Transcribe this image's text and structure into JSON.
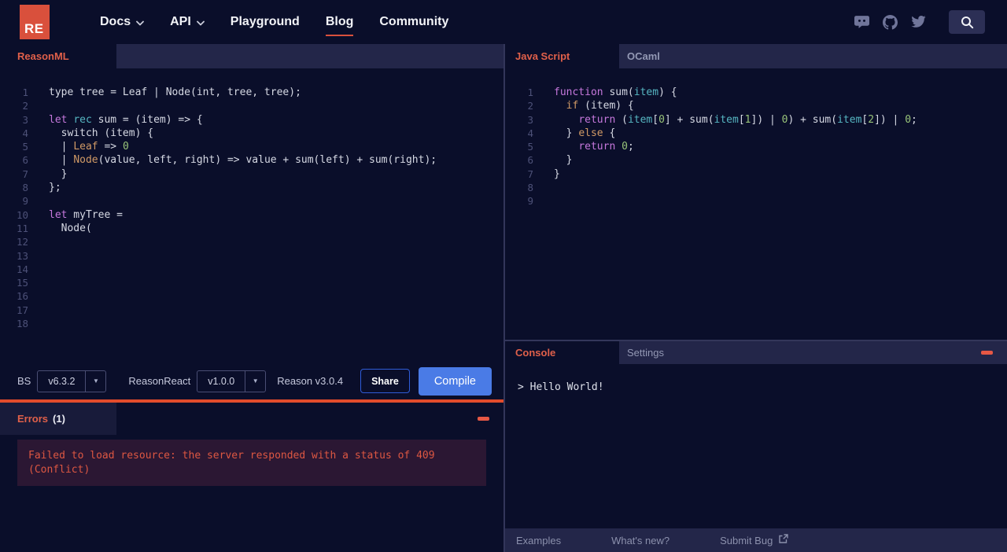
{
  "accent": {
    "red": "#d9503c",
    "divider_orange": "#e24c2c",
    "compile_blue": "#4a7be6",
    "tab_label_red": "#e0604a"
  },
  "nav": {
    "logo_text": "RE",
    "items": [
      {
        "label": "Docs",
        "chevron": true,
        "active": false
      },
      {
        "label": "API",
        "chevron": true,
        "active": false
      },
      {
        "label": "Playground",
        "chevron": false,
        "active": false
      },
      {
        "label": "Blog",
        "chevron": false,
        "active": true
      },
      {
        "label": "Community",
        "chevron": false,
        "active": false
      }
    ],
    "social_icons": [
      "discord",
      "github",
      "twitter"
    ],
    "search_icon": "search"
  },
  "left_editor": {
    "tab_label": "ReasonML",
    "lines": [
      [
        [
          "p",
          "type tree = Leaf | Node(int, tree, tree);"
        ]
      ],
      [],
      [
        [
          "m",
          "let"
        ],
        [
          "p",
          " "
        ],
        [
          "c",
          "rec"
        ],
        [
          "p",
          " sum = (item) => {"
        ]
      ],
      [
        [
          "p",
          "  switch (item) {"
        ]
      ],
      [
        [
          "p",
          "  | "
        ],
        [
          "o",
          "Leaf"
        ],
        [
          "p",
          " => "
        ],
        [
          "g",
          "0"
        ]
      ],
      [
        [
          "p",
          "  | "
        ],
        [
          "o",
          "Node"
        ],
        [
          "p",
          "(value, left, right) => value + sum(left) + sum(right);"
        ]
      ],
      [
        [
          "p",
          "  }"
        ]
      ],
      [
        [
          "p",
          "};"
        ]
      ],
      [],
      [
        [
          "m",
          "let"
        ],
        [
          "p",
          " myTree ="
        ]
      ],
      [
        [
          "p",
          "  Node("
        ]
      ],
      [],
      [],
      [],
      [],
      [],
      [],
      []
    ]
  },
  "right_editor": {
    "tabs": [
      {
        "label": "Java Script",
        "active": true
      },
      {
        "label": "OCaml",
        "active": false
      }
    ],
    "lines": [
      [
        [
          "m",
          "function"
        ],
        [
          "p",
          " sum("
        ],
        [
          "c",
          "item"
        ],
        [
          "p",
          ") {"
        ]
      ],
      [
        [
          "p",
          "  "
        ],
        [
          "o",
          "if"
        ],
        [
          "p",
          " (item) {"
        ]
      ],
      [
        [
          "p",
          "    "
        ],
        [
          "m",
          "return"
        ],
        [
          "p",
          " ("
        ],
        [
          "c",
          "item"
        ],
        [
          "p",
          "["
        ],
        [
          "g",
          "0"
        ],
        [
          "p",
          "] + sum("
        ],
        [
          "c",
          "item"
        ],
        [
          "p",
          "["
        ],
        [
          "g",
          "1"
        ],
        [
          "p",
          "]) | "
        ],
        [
          "g",
          "0"
        ],
        [
          "p",
          ") + sum("
        ],
        [
          "c",
          "item"
        ],
        [
          "p",
          "["
        ],
        [
          "g",
          "2"
        ],
        [
          "p",
          "]) | "
        ],
        [
          "g",
          "0"
        ],
        [
          "p",
          ";"
        ]
      ],
      [
        [
          "p",
          "  } "
        ],
        [
          "o",
          "else"
        ],
        [
          "p",
          " {"
        ]
      ],
      [
        [
          "p",
          "    "
        ],
        [
          "m",
          "return"
        ],
        [
          "p",
          " "
        ],
        [
          "g",
          "0"
        ],
        [
          "p",
          ";"
        ]
      ],
      [
        [
          "p",
          "  }"
        ]
      ],
      [
        [
          "p",
          "}"
        ]
      ],
      [],
      []
    ]
  },
  "toolbar": {
    "bs_label": "BS",
    "bs_version": "v6.3.2",
    "reasonreact_label": "ReasonReact",
    "reasonreact_version": "v1.0.0",
    "reason_version_text": "Reason v3.0.4",
    "share_label": "Share",
    "compile_label": "Compile"
  },
  "errors": {
    "title": "Errors",
    "count": "(1)",
    "message_lines": [
      "Failed to load resource: the server responded with a status of 409",
      "(Conflict)"
    ]
  },
  "console": {
    "tab_label": "Console",
    "settings_label": "Settings",
    "output": "> Hello World!"
  },
  "footer": {
    "links": [
      {
        "label": "Examples",
        "external": false
      },
      {
        "label": "What's new?",
        "external": false
      },
      {
        "label": "Submit Bug",
        "external": true
      }
    ]
  }
}
